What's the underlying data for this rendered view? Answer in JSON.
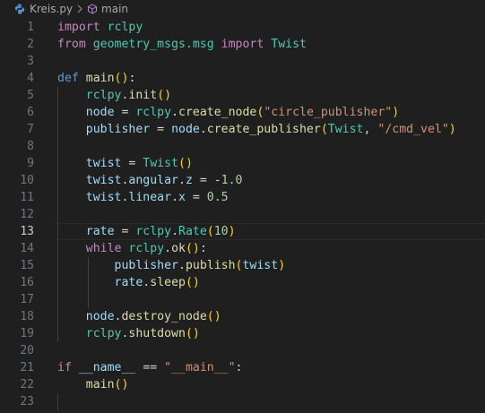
{
  "breadcrumb": {
    "file_name": "Kreis.py",
    "file_icon": "python-file-icon",
    "symbol_icon": "function-cube-icon",
    "symbol_name": "main"
  },
  "editor": {
    "current_line": 13,
    "line_numbers": [
      "1",
      "2",
      "3",
      "4",
      "5",
      "6",
      "7",
      "8",
      "9",
      "10",
      "11",
      "12",
      "13",
      "14",
      "15",
      "16",
      "17",
      "18",
      "19",
      "20",
      "21",
      "22",
      "23"
    ],
    "lines": [
      [
        [
          "kw",
          "import"
        ],
        [
          "plain",
          " "
        ],
        [
          "mod",
          "rclpy"
        ]
      ],
      [
        [
          "kw",
          "from"
        ],
        [
          "plain",
          " "
        ],
        [
          "mod",
          "geometry_msgs.msg"
        ],
        [
          "plain",
          " "
        ],
        [
          "kw",
          "import"
        ],
        [
          "plain",
          " "
        ],
        [
          "mod",
          "Twist"
        ]
      ],
      [],
      [
        [
          "def",
          "def"
        ],
        [
          "plain",
          " "
        ],
        [
          "fn",
          "main"
        ],
        [
          "p1",
          "()"
        ],
        [
          "op",
          ":"
        ]
      ],
      [
        [
          "plain",
          "    "
        ],
        [
          "mod",
          "rclpy"
        ],
        [
          "op",
          "."
        ],
        [
          "fn",
          "init"
        ],
        [
          "p1",
          "()"
        ]
      ],
      [
        [
          "plain",
          "    "
        ],
        [
          "var",
          "node"
        ],
        [
          "op",
          " = "
        ],
        [
          "mod",
          "rclpy"
        ],
        [
          "op",
          "."
        ],
        [
          "fn",
          "create_node"
        ],
        [
          "p1",
          "("
        ],
        [
          "str",
          "\"circle_publisher\""
        ],
        [
          "p1",
          ")"
        ]
      ],
      [
        [
          "plain",
          "    "
        ],
        [
          "var",
          "publisher"
        ],
        [
          "op",
          " = "
        ],
        [
          "var",
          "node"
        ],
        [
          "op",
          "."
        ],
        [
          "fn",
          "create_publisher"
        ],
        [
          "p1",
          "("
        ],
        [
          "mod",
          "Twist"
        ],
        [
          "op",
          ", "
        ],
        [
          "str",
          "\"/cmd_vel\""
        ],
        [
          "p1",
          ")"
        ]
      ],
      [],
      [
        [
          "plain",
          "    "
        ],
        [
          "var",
          "twist"
        ],
        [
          "op",
          " = "
        ],
        [
          "mod",
          "Twist"
        ],
        [
          "p1",
          "()"
        ]
      ],
      [
        [
          "plain",
          "    "
        ],
        [
          "var",
          "twist"
        ],
        [
          "op",
          "."
        ],
        [
          "var",
          "angular"
        ],
        [
          "op",
          "."
        ],
        [
          "var",
          "z"
        ],
        [
          "op",
          " = -"
        ],
        [
          "num",
          "1.0"
        ]
      ],
      [
        [
          "plain",
          "    "
        ],
        [
          "var",
          "twist"
        ],
        [
          "op",
          "."
        ],
        [
          "var",
          "linear"
        ],
        [
          "op",
          "."
        ],
        [
          "var",
          "x"
        ],
        [
          "op",
          " = "
        ],
        [
          "num",
          "0.5"
        ]
      ],
      [],
      [
        [
          "plain",
          "    "
        ],
        [
          "var",
          "rate"
        ],
        [
          "op",
          " = "
        ],
        [
          "mod",
          "rclpy"
        ],
        [
          "op",
          "."
        ],
        [
          "mod",
          "Rate"
        ],
        [
          "p1",
          "("
        ],
        [
          "num",
          "10"
        ],
        [
          "p1",
          ")"
        ]
      ],
      [
        [
          "plain",
          "    "
        ],
        [
          "kw",
          "while"
        ],
        [
          "plain",
          " "
        ],
        [
          "mod",
          "rclpy"
        ],
        [
          "op",
          "."
        ],
        [
          "fn",
          "ok"
        ],
        [
          "p1",
          "()"
        ],
        [
          "op",
          ":"
        ]
      ],
      [
        [
          "plain",
          "        "
        ],
        [
          "var",
          "publisher"
        ],
        [
          "op",
          "."
        ],
        [
          "fn",
          "publish"
        ],
        [
          "p1",
          "("
        ],
        [
          "var",
          "twist"
        ],
        [
          "p1",
          ")"
        ]
      ],
      [
        [
          "plain",
          "        "
        ],
        [
          "var",
          "rate"
        ],
        [
          "op",
          "."
        ],
        [
          "fn",
          "sleep"
        ],
        [
          "p1",
          "()"
        ]
      ],
      [],
      [
        [
          "plain",
          "    "
        ],
        [
          "var",
          "node"
        ],
        [
          "op",
          "."
        ],
        [
          "fn",
          "destroy_node"
        ],
        [
          "p1",
          "()"
        ]
      ],
      [
        [
          "plain",
          "    "
        ],
        [
          "mod",
          "rclpy"
        ],
        [
          "op",
          "."
        ],
        [
          "fn",
          "shutdown"
        ],
        [
          "p1",
          "()"
        ]
      ],
      [],
      [
        [
          "kw",
          "if"
        ],
        [
          "plain",
          " "
        ],
        [
          "var",
          "__name__"
        ],
        [
          "op",
          " == "
        ],
        [
          "str",
          "\"__main__\""
        ],
        [
          "op",
          ":"
        ]
      ],
      [
        [
          "plain",
          "    "
        ],
        [
          "fn",
          "main"
        ],
        [
          "p1",
          "()"
        ]
      ],
      []
    ]
  }
}
